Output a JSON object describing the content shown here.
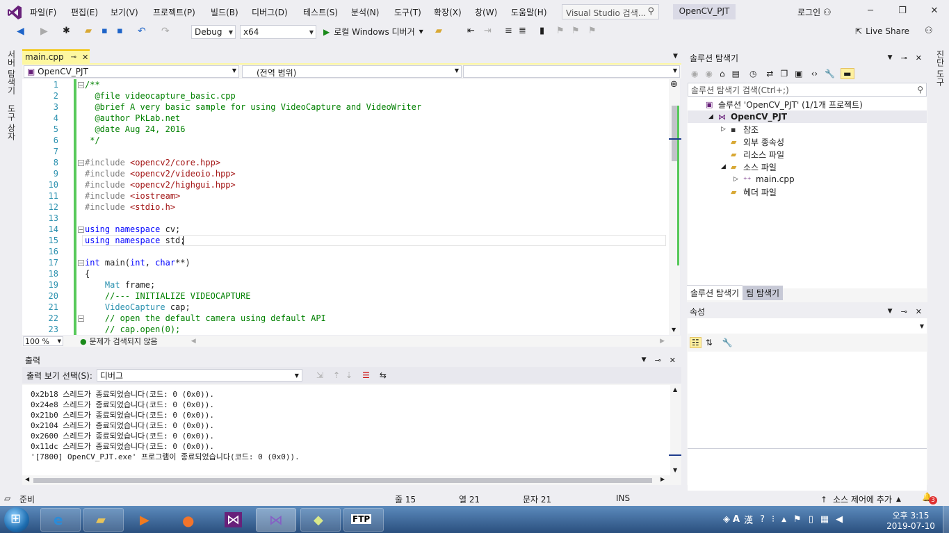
{
  "menu": {
    "items": [
      "파일(F)",
      "편집(E)",
      "보기(V)",
      "프로젝트(P)",
      "빌드(B)",
      "디버그(D)",
      "테스트(S)",
      "분석(N)",
      "도구(T)",
      "확장(X)",
      "창(W)",
      "도움말(H)"
    ],
    "search_placeholder": "Visual Studio 검색...",
    "project_tab": "OpenCV_PJT",
    "login": "로그인"
  },
  "toolbar": {
    "config": "Debug",
    "platform": "x64",
    "run_label": "로컬 Windows 디버거",
    "live_share": "Live Share"
  },
  "left_vtabs": [
    "서버 탐색기",
    "도구 상자"
  ],
  "right_vtabs": [
    "진단 도구"
  ],
  "editor": {
    "tab_label": "main.cpp",
    "pin_glyph": "⊸",
    "nav_project": "OpenCV_PJT",
    "nav_scope": "(전역 범위)",
    "line_numbers": [
      "1",
      "2",
      "3",
      "4",
      "5",
      "6",
      "7",
      "8",
      "9",
      "10",
      "11",
      "12",
      "13",
      "14",
      "15",
      "16",
      "17",
      "18",
      "19",
      "20",
      "21",
      "22",
      "23"
    ],
    "zoom": "100 %",
    "status": "문제가 검색되지 않음"
  },
  "code": [
    [
      {
        "t": "/**",
        "c": "com"
      }
    ],
    [
      {
        "t": "  @file videocapture_basic.cpp",
        "c": "com"
      }
    ],
    [
      {
        "t": "  @brief A very basic sample for using VideoCapture and VideoWriter",
        "c": "com"
      }
    ],
    [
      {
        "t": "  @author PkLab.net",
        "c": "com"
      }
    ],
    [
      {
        "t": "  @date Aug 24, 2016",
        "c": "com"
      }
    ],
    [
      {
        "t": " */",
        "c": "com"
      }
    ],
    [],
    [
      {
        "t": "#include ",
        "c": "pp"
      },
      {
        "t": "<opencv2/core.hpp>",
        "c": "str"
      }
    ],
    [
      {
        "t": "#include ",
        "c": "pp"
      },
      {
        "t": "<opencv2/videoio.hpp>",
        "c": "str"
      }
    ],
    [
      {
        "t": "#include ",
        "c": "pp"
      },
      {
        "t": "<opencv2/highgui.hpp>",
        "c": "str"
      }
    ],
    [
      {
        "t": "#include ",
        "c": "pp"
      },
      {
        "t": "<iostream>",
        "c": "str"
      }
    ],
    [
      {
        "t": "#include ",
        "c": "pp"
      },
      {
        "t": "<stdio.h>",
        "c": "str"
      }
    ],
    [],
    [
      {
        "t": "using namespace ",
        "c": "kw"
      },
      {
        "t": "cv;",
        "c": "plain"
      }
    ],
    [
      {
        "t": "using namespace ",
        "c": "kw"
      },
      {
        "t": "std;",
        "c": "plain"
      }
    ],
    [],
    [
      {
        "t": "int ",
        "c": "kw"
      },
      {
        "t": "main(",
        "c": "plain"
      },
      {
        "t": "int",
        "c": "kw"
      },
      {
        "t": ", ",
        "c": "plain"
      },
      {
        "t": "char",
        "c": "kw"
      },
      {
        "t": "**)",
        "c": "plain"
      }
    ],
    [
      {
        "t": "{",
        "c": "plain"
      }
    ],
    [
      {
        "t": "    ",
        "c": "plain"
      },
      {
        "t": "Mat",
        "c": "type"
      },
      {
        "t": " frame;",
        "c": "plain"
      }
    ],
    [
      {
        "t": "    //--- INITIALIZE VIDEOCAPTURE",
        "c": "com"
      }
    ],
    [
      {
        "t": "    ",
        "c": "plain"
      },
      {
        "t": "VideoCapture",
        "c": "type"
      },
      {
        "t": " cap;",
        "c": "plain"
      }
    ],
    [
      {
        "t": "    // open the default camera using default API",
        "c": "com"
      }
    ],
    [
      {
        "t": "    // cap.open(0);",
        "c": "com"
      }
    ]
  ],
  "solution_explorer": {
    "title": "솔루션 탐색기",
    "search_placeholder": "솔루션 탐색기 검색(Ctrl+;)",
    "items": [
      {
        "label": "솔루션 'OpenCV_PJT' (1/1개 프로젝트)",
        "icon": "solution-icon",
        "indent": 0,
        "arrow": ""
      },
      {
        "label": "OpenCV_PJT",
        "icon": "project-icon",
        "indent": 1,
        "arrow": "◢",
        "bold": true
      },
      {
        "label": "참조",
        "icon": "references-icon",
        "indent": 2,
        "arrow": "▷"
      },
      {
        "label": "외부 종속성",
        "icon": "folder-icon",
        "indent": 2,
        "arrow": ""
      },
      {
        "label": "리소스 파일",
        "icon": "folder-icon",
        "indent": 2,
        "arrow": ""
      },
      {
        "label": "소스 파일",
        "icon": "folder-icon",
        "indent": 2,
        "arrow": "◢"
      },
      {
        "label": "main.cpp",
        "icon": "cpp-file-icon",
        "indent": 3,
        "arrow": "▷"
      },
      {
        "label": "헤더 파일",
        "icon": "folder-icon",
        "indent": 2,
        "arrow": ""
      }
    ],
    "bottom_tabs": [
      "솔루션 탐색기",
      "팀 탐색기"
    ]
  },
  "properties": {
    "title": "속성"
  },
  "output": {
    "title": "출력",
    "source_label": "출력 보기 선택(S):",
    "source_value": "디버그",
    "lines": [
      "0x2b18 스레드가 종료되었습니다(코드: 0 (0x0)).",
      "0x24e8 스레드가 종료되었습니다(코드: 0 (0x0)).",
      "0x21b0 스레드가 종료되었습니다(코드: 0 (0x0)).",
      "0x2104 스레드가 종료되었습니다(코드: 0 (0x0)).",
      "0x2600 스레드가 종료되었습니다(코드: 0 (0x0)).",
      "0x11dc 스레드가 종료되었습니다(코드: 0 (0x0)).",
      "'[7800] OpenCV_PJT.exe' 프로그램이 종료되었습니다(코드: 0 (0x0))."
    ]
  },
  "statusbar": {
    "ready": "준비",
    "line": "줄 15",
    "col": "열 21",
    "ch": "문자 21",
    "ins": "INS",
    "source_control": "소스 제어에 추가",
    "notif_count": "3"
  },
  "taskbar": {
    "time": "오후 3:15",
    "date": "2019-07-10",
    "ime_a": "A",
    "ime_han": "漢"
  }
}
